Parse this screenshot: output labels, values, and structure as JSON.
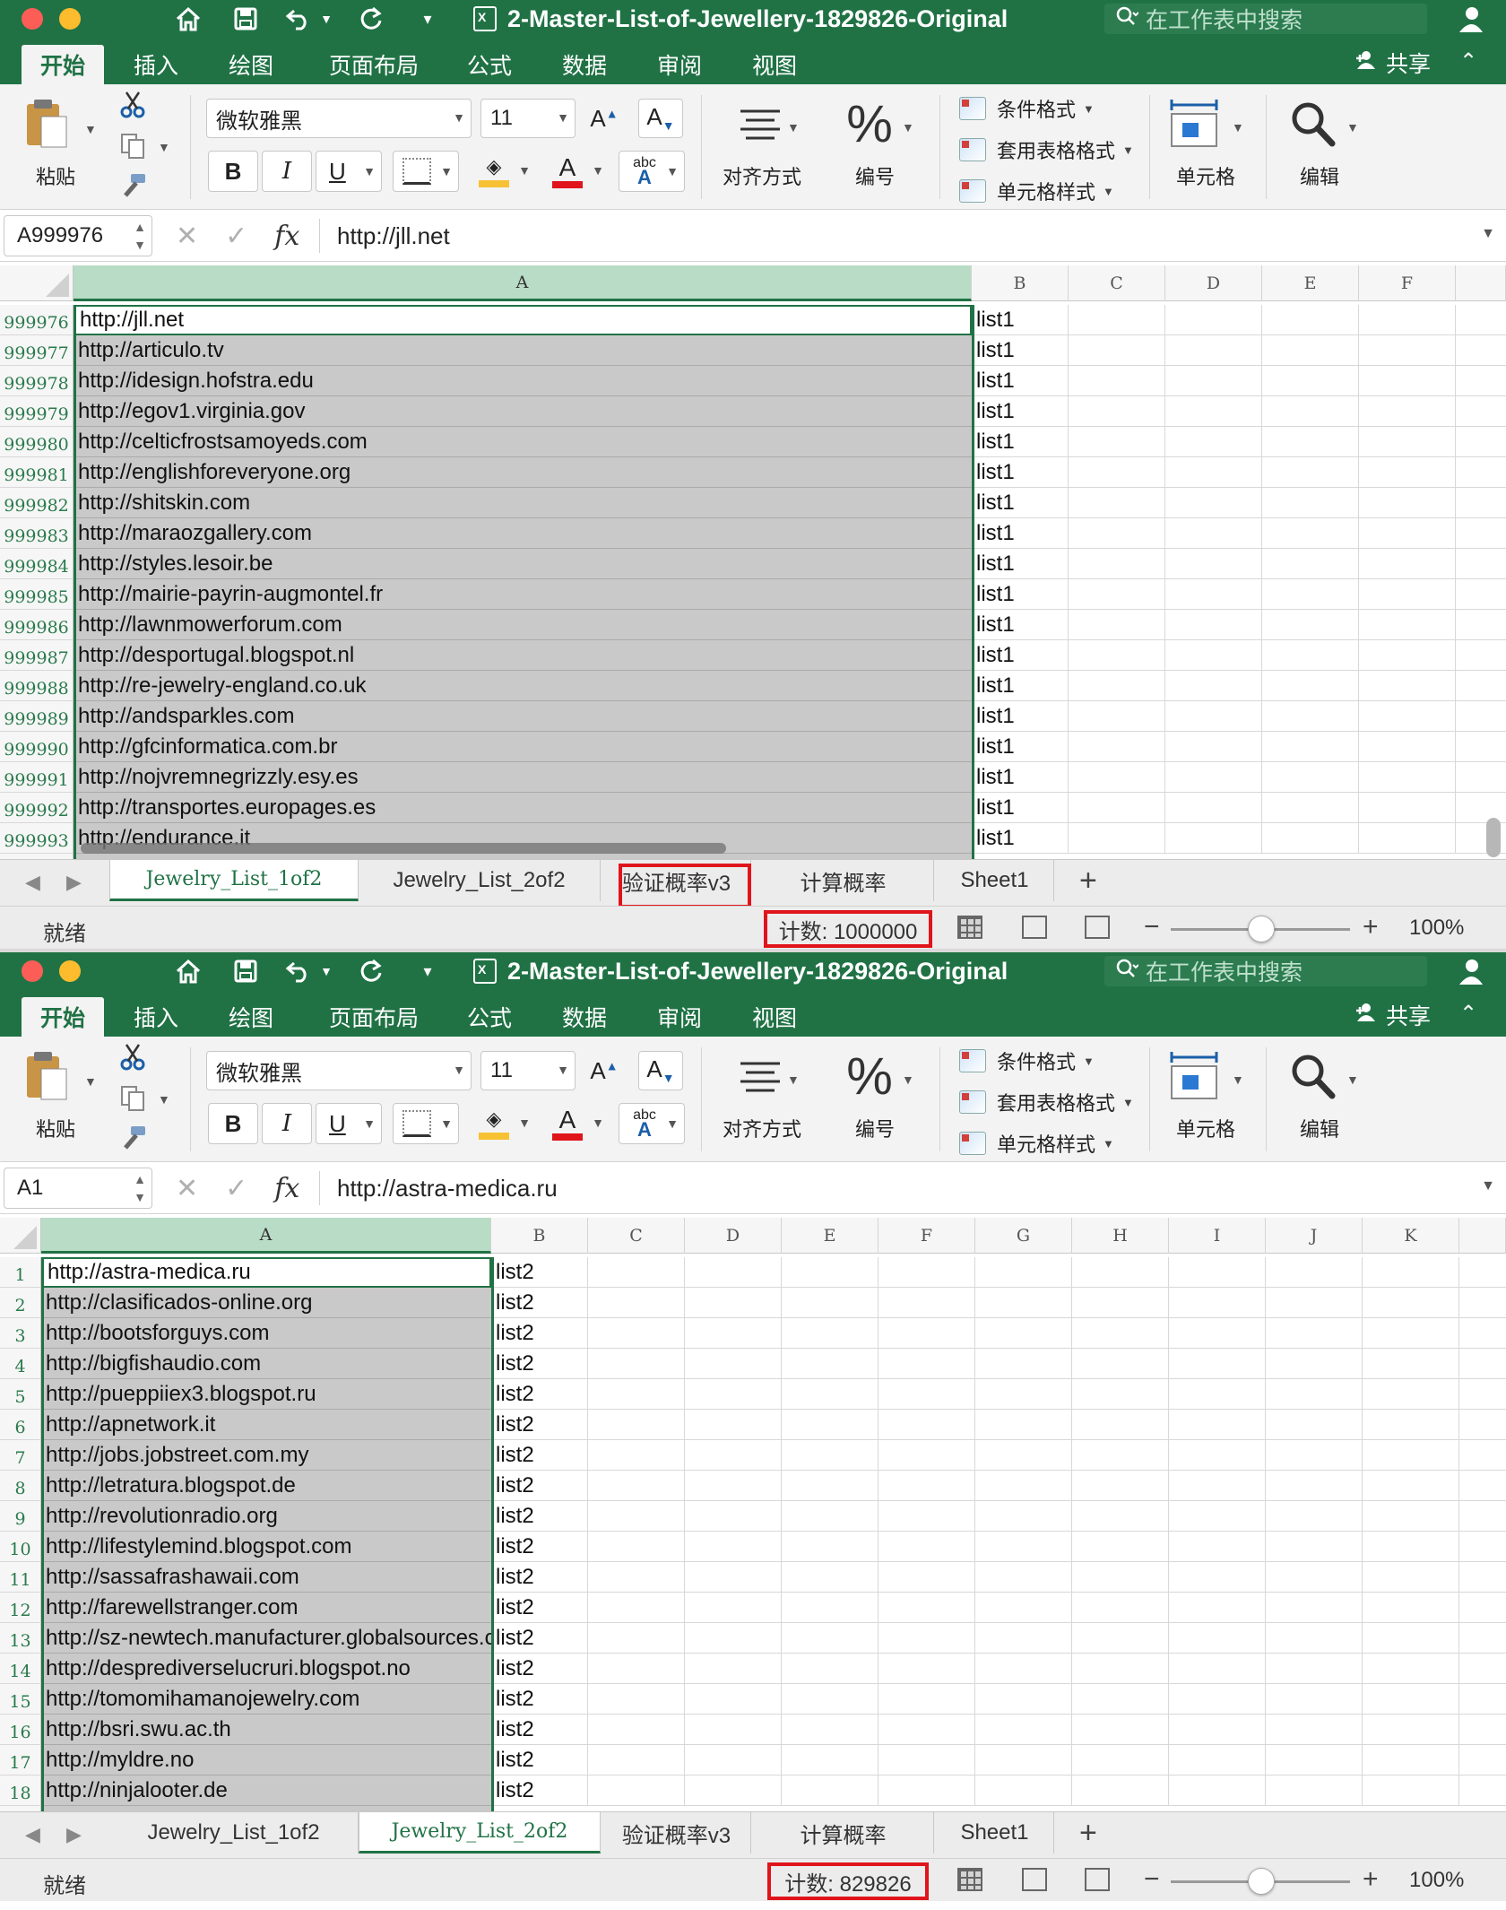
{
  "colors": {
    "excel_green": "#207245",
    "highlight_red": "#e0141b",
    "selection_gray": "#c9c9c9"
  },
  "windows": [
    {
      "title": "2-Master-List-of-Jewellery-1829826-Original",
      "search_placeholder": "在工作表中搜索",
      "tabs": [
        "开始",
        "插入",
        "绘图",
        "页面布局",
        "公式",
        "数据",
        "审阅",
        "视图"
      ],
      "share_label": "共享",
      "ribbon": {
        "paste": "粘贴",
        "font": "微软雅黑",
        "size": "11",
        "bold": "B",
        "italic": "I",
        "underline": "U",
        "align": "对齐方式",
        "number": "编号",
        "cond_format": "条件格式",
        "table_format": "套用表格格式",
        "cell_style": "单元格样式",
        "cells": "单元格",
        "edit": "编辑"
      },
      "namebox": "A999976",
      "formula": "http://jll.net",
      "columns": [
        "A",
        "B",
        "C",
        "D",
        "E",
        "F"
      ],
      "rows": [
        {
          "n": "999976",
          "a": "http://jll.net",
          "b": "list1"
        },
        {
          "n": "999977",
          "a": "http://articulo.tv",
          "b": "list1"
        },
        {
          "n": "999978",
          "a": "http://idesign.hofstra.edu",
          "b": "list1"
        },
        {
          "n": "999979",
          "a": "http://egov1.virginia.gov",
          "b": "list1"
        },
        {
          "n": "999980",
          "a": "http://celticfrostsamoyeds.com",
          "b": "list1"
        },
        {
          "n": "999981",
          "a": "http://englishforeveryone.org",
          "b": "list1"
        },
        {
          "n": "999982",
          "a": "http://shitskin.com",
          "b": "list1"
        },
        {
          "n": "999983",
          "a": "http://maraozgallery.com",
          "b": "list1"
        },
        {
          "n": "999984",
          "a": "http://styles.lesoir.be",
          "b": "list1"
        },
        {
          "n": "999985",
          "a": "http://mairie-payrin-augmontel.fr",
          "b": "list1"
        },
        {
          "n": "999986",
          "a": "http://lawnmowerforum.com",
          "b": "list1"
        },
        {
          "n": "999987",
          "a": "http://desportugal.blogspot.nl",
          "b": "list1"
        },
        {
          "n": "999988",
          "a": "http://re-jewelry-england.co.uk",
          "b": "list1"
        },
        {
          "n": "999989",
          "a": "http://andsparkles.com",
          "b": "list1"
        },
        {
          "n": "999990",
          "a": "http://gfcinformatica.com.br",
          "b": "list1"
        },
        {
          "n": "999991",
          "a": "http://nojvremnegrizzly.esy.es",
          "b": "list1"
        },
        {
          "n": "999992",
          "a": "http://transportes.europages.es",
          "b": "list1"
        },
        {
          "n": "999993",
          "a": "http://endurance.it",
          "b": "list1"
        }
      ],
      "sheets": [
        "Jewelry_List_1of2",
        "Jewelry_List_2of2",
        "验证概率v3",
        "计算概率",
        "Sheet1"
      ],
      "active_sheet": 0,
      "status_ready": "就绪",
      "status_count": "计数: 1000000",
      "zoom": "100%"
    },
    {
      "title": "2-Master-List-of-Jewellery-1829826-Original",
      "search_placeholder": "在工作表中搜索",
      "tabs": [
        "开始",
        "插入",
        "绘图",
        "页面布局",
        "公式",
        "数据",
        "审阅",
        "视图"
      ],
      "share_label": "共享",
      "ribbon": {
        "paste": "粘贴",
        "font": "微软雅黑",
        "size": "11",
        "bold": "B",
        "italic": "I",
        "underline": "U",
        "align": "对齐方式",
        "number": "编号",
        "cond_format": "条件格式",
        "table_format": "套用表格格式",
        "cell_style": "单元格样式",
        "cells": "单元格",
        "edit": "编辑"
      },
      "namebox": "A1",
      "formula": "http://astra-medica.ru",
      "columns": [
        "A",
        "B",
        "C",
        "D",
        "E",
        "F",
        "G",
        "H",
        "I",
        "J",
        "K"
      ],
      "rows": [
        {
          "n": "1",
          "a": "http://astra-medica.ru",
          "b": "list2"
        },
        {
          "n": "2",
          "a": "http://clasificados-online.org",
          "b": "list2"
        },
        {
          "n": "3",
          "a": "http://bootsforguys.com",
          "b": "list2"
        },
        {
          "n": "4",
          "a": "http://bigfishaudio.com",
          "b": "list2"
        },
        {
          "n": "5",
          "a": "http://pueppiiex3.blogspot.ru",
          "b": "list2"
        },
        {
          "n": "6",
          "a": "http://apnetwork.it",
          "b": "list2"
        },
        {
          "n": "7",
          "a": "http://jobs.jobstreet.com.my",
          "b": "list2"
        },
        {
          "n": "8",
          "a": "http://letratura.blogspot.de",
          "b": "list2"
        },
        {
          "n": "9",
          "a": "http://revolutionradio.org",
          "b": "list2"
        },
        {
          "n": "10",
          "a": "http://lifestylemind.blogspot.com",
          "b": "list2"
        },
        {
          "n": "11",
          "a": "http://sassafrashawaii.com",
          "b": "list2"
        },
        {
          "n": "12",
          "a": "http://farewellstranger.com",
          "b": "list2"
        },
        {
          "n": "13",
          "a": "http://sz-newtech.manufacturer.globalsources.com",
          "b": "list2"
        },
        {
          "n": "14",
          "a": "http://desprediverselucruri.blogspot.no",
          "b": "list2"
        },
        {
          "n": "15",
          "a": "http://tomomihamanojewelry.com",
          "b": "list2"
        },
        {
          "n": "16",
          "a": "http://bsri.swu.ac.th",
          "b": "list2"
        },
        {
          "n": "17",
          "a": "http://myldre.no",
          "b": "list2"
        },
        {
          "n": "18",
          "a": "http://ninjalooter.de",
          "b": "list2"
        }
      ],
      "sheets": [
        "Jewelry_List_1of2",
        "Jewelry_List_2of2",
        "验证概率v3",
        "计算概率",
        "Sheet1"
      ],
      "active_sheet": 1,
      "status_ready": "就绪",
      "status_count": "计数: 829826",
      "zoom": "100%"
    }
  ]
}
